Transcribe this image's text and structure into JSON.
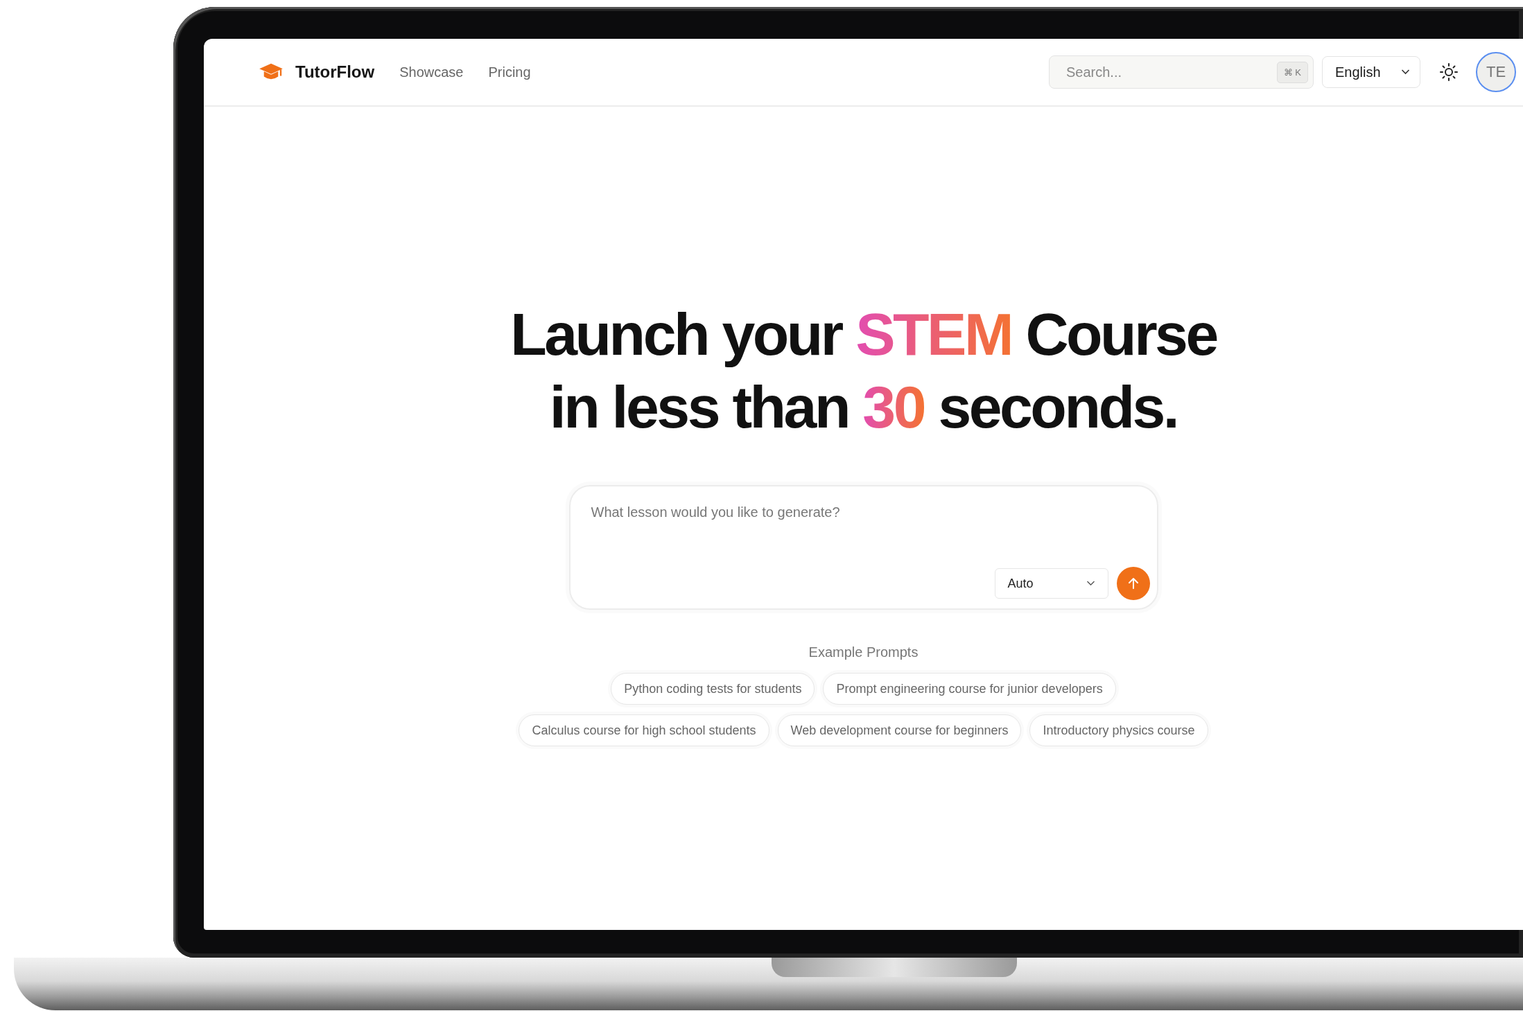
{
  "header": {
    "brand": "TutorFlow",
    "nav": [
      "Showcase",
      "Pricing"
    ],
    "search": {
      "placeholder": "Search...",
      "shortcut": "⌘ K"
    },
    "language": {
      "value": "English"
    },
    "avatar": "TE"
  },
  "hero": {
    "lines": [
      [
        {
          "text": "Launch your ",
          "highlight": false
        },
        {
          "text": "STEM",
          "highlight": true
        },
        {
          "text": " Course",
          "highlight": false
        }
      ],
      [
        {
          "text": "in less than ",
          "highlight": false
        },
        {
          "text": "30",
          "highlight": true
        },
        {
          "text": " seconds.",
          "highlight": false
        }
      ]
    ]
  },
  "prompt_box": {
    "placeholder": "What lesson would you like to generate?",
    "mode": "Auto"
  },
  "example_prompts": {
    "title": "Example Prompts",
    "rows": [
      [
        "Python coding tests for students",
        "Prompt engineering course for junior developers"
      ],
      [
        "Calculus course for high school students",
        "Web development course for beginners",
        "Introductory physics course"
      ]
    ]
  }
}
